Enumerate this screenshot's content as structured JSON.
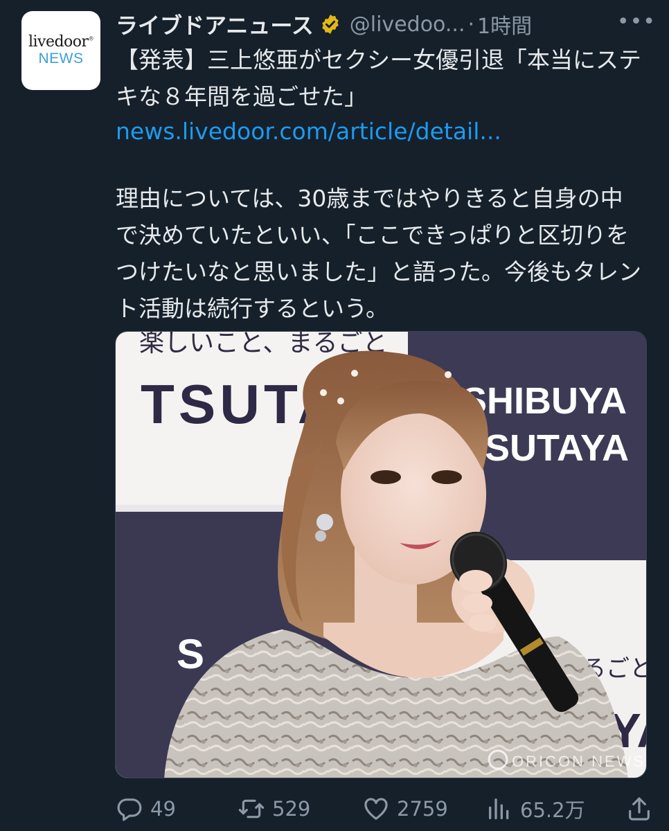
{
  "author": {
    "avatar_line1": "livedoor",
    "avatar_line2": "NEWS",
    "display_name": "ライブドアニュース",
    "handle": "@livedoo...",
    "separator": "·",
    "time": "1時間",
    "more": "•••",
    "verified_color": "#e2b719"
  },
  "tweet": {
    "headline": "【発表】三上悠亜がセクシー女優引退「本当にステキな８年間を過ごせた」",
    "link": "news.livedoor.com/article/detail...",
    "body": "理由については、30歳まではやりきると自身の中で決めていたといい、「ここできっぱりと区切りをつけたいなと思いました」と語った。今後もタレント活動は続行するという。"
  },
  "photo": {
    "sign_left_top": "楽しいこと、まるごと",
    "sign_left_brand": "TSUTA",
    "sign_right_line1": "SHIBUYA",
    "sign_right_line2": "TSUTAYA",
    "sign_lower_right": "まるごと",
    "sign_lower_brand": "AYA",
    "sign_lower_left": "S",
    "watermark": "ORICON NEWS"
  },
  "actions": {
    "replies": "49",
    "retweets": "529",
    "likes": "2759",
    "views": "65.2万"
  },
  "colors": {
    "background": "#15202b",
    "link": "#1d9bf0",
    "muted": "#8b98a5",
    "text": "#e7e9ea"
  }
}
